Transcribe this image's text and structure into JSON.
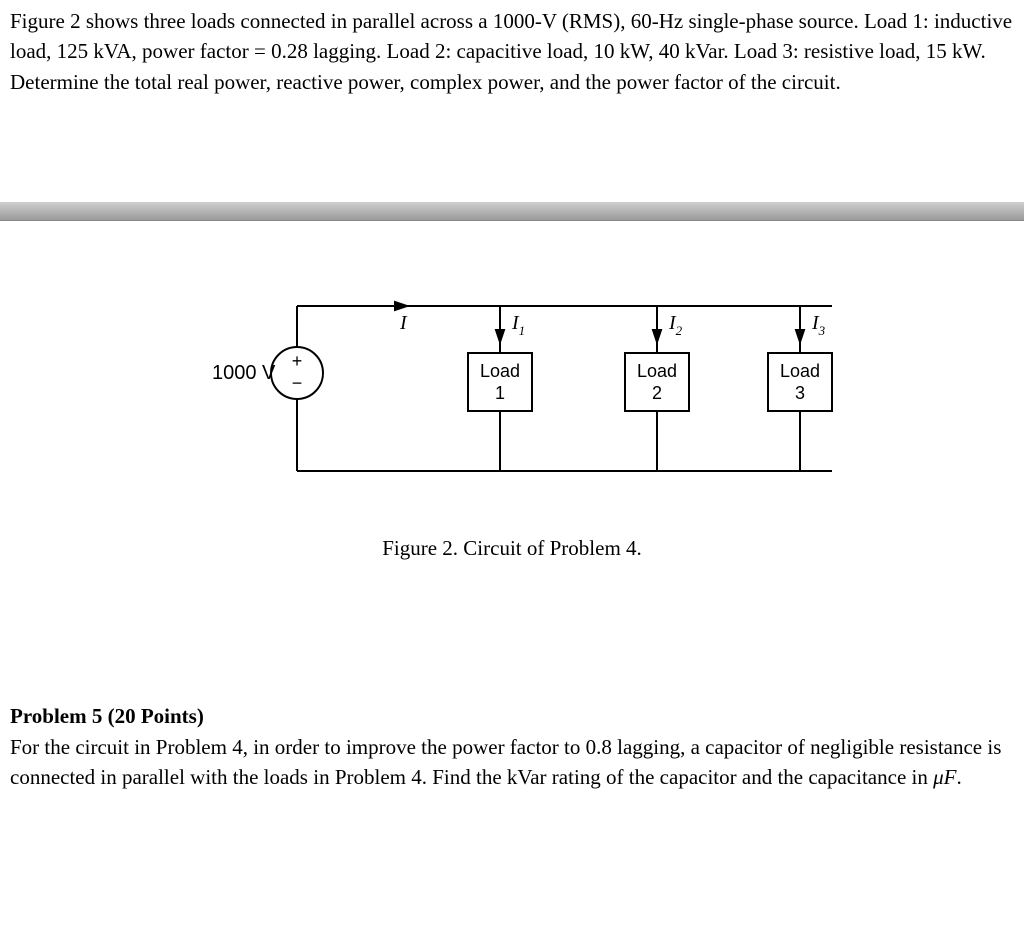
{
  "problem4": {
    "text": "Figure 2 shows three loads connected in parallel across a 1000-V (RMS), 60-Hz single-phase source. Load 1: inductive load, 125 kVA, power factor = 0.28 lagging. Load 2: capacitive load, 10 kW, 40 kVar. Load 3: resistive load, 15 kW. Determine the total real power, reactive power, complex power, and the power factor of the circuit."
  },
  "figure": {
    "source_label": "1000 V",
    "plus": "+",
    "minus": "−",
    "I": "I",
    "I1": "I",
    "I1_sub": "1",
    "I2": "I",
    "I2_sub": "2",
    "I3": "I",
    "I3_sub": "3",
    "load_word": "Load",
    "load1_num": "1",
    "load2_num": "2",
    "load3_num": "3",
    "caption": "Figure 2. Circuit of Problem 4."
  },
  "problem5": {
    "title": "Problem 5 (20 Points)",
    "text_a": "For the circuit in Problem 4, in order to improve the power factor to 0.8 lagging, a capacitor of negligible resistance is connected in parallel with the loads in Problem 4. Find the kVar rating of the capacitor and the capacitance in ",
    "mu_f": "μF",
    "text_b": "."
  }
}
